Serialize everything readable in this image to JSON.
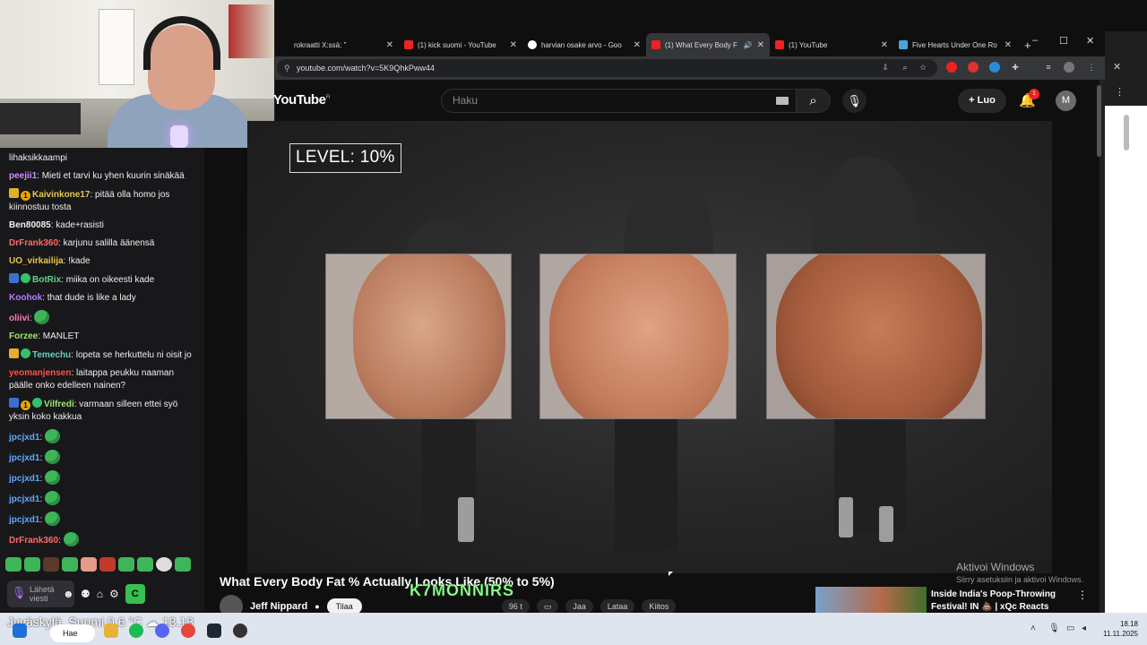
{
  "chat": {
    "messages": [
      {
        "user": "",
        "text": "lihaksikkaampi",
        "badges": []
      },
      {
        "user": "peejii1",
        "text": "Mieti et tarvi ku yhen kuurin sinäkää",
        "badges": [],
        "color": "#d68cff"
      },
      {
        "user": "Kaivinkone17",
        "text": "pitää olla homo jos kiinnostuu tosta",
        "badges": [
          "crown",
          "one"
        ],
        "color": "#e6c84a"
      },
      {
        "user": "Ben80085",
        "text": "kade+rasisti",
        "badges": [],
        "color": "#efeff1"
      },
      {
        "user": "DrFrank360",
        "text": "karjunu salilla äänensä",
        "badges": [],
        "color": "#ff6b6b"
      },
      {
        "user": "UO_virkailija",
        "text": "!kade",
        "badges": [],
        "color": "#e6c84a"
      },
      {
        "user": "BotRix",
        "text": "miika on oikeesti kade",
        "badges": [
          "blue",
          "green"
        ],
        "color": "#5fd38d"
      },
      {
        "user": "Koohok",
        "text": "that dude is like a lady",
        "badges": [],
        "color": "#b57cff"
      },
      {
        "user": "oliivi",
        "text": "",
        "badges": [],
        "color": "#ff7ab8",
        "emote": true
      },
      {
        "user": "Forzee",
        "text": "MANLET",
        "badges": [],
        "color": "#9ee66e"
      },
      {
        "user": "Temechu",
        "text": "lopeta se herkuttelu ni oisit jo",
        "badges": [
          "crown",
          "green"
        ],
        "color": "#5fd3c0"
      },
      {
        "user": "yeomanjensen",
        "text": "laitappa peukku naaman päälle onko edelleen nainen?",
        "badges": [],
        "color": "#ff4f4f"
      },
      {
        "user": "Vilfredi",
        "text": "varmaan silleen ettei syö yksin koko kakkua",
        "badges": [
          "blue",
          "one",
          "green"
        ],
        "color": "#9ee66e"
      },
      {
        "user": "jpcjxd1",
        "text": "",
        "badges": [],
        "color": "#5fa8ff",
        "emote": true
      },
      {
        "user": "jpcjxd1",
        "text": "",
        "badges": [],
        "color": "#5fa8ff",
        "emote": true
      },
      {
        "user": "jpcjxd1",
        "text": "",
        "badges": [],
        "color": "#5fa8ff",
        "emote": true
      },
      {
        "user": "jpcjxd1",
        "text": "",
        "badges": [],
        "color": "#5fa8ff",
        "emote": true
      },
      {
        "user": "jpcjxd1",
        "text": "",
        "badges": [],
        "color": "#5fa8ff",
        "emote": true
      },
      {
        "user": "DrFrank360",
        "text": "",
        "badges": [],
        "color": "#ff6b6b",
        "emote": true
      }
    ],
    "input_placeholder": "Lähetä viesti",
    "send_label": "C"
  },
  "browser": {
    "tabs": [
      {
        "title": "rokraatti X:ssä: \"",
        "icon": "x",
        "active": false
      },
      {
        "title": "(1) kick suomi - YouTube",
        "icon": "yt",
        "active": false
      },
      {
        "title": "harvian osake arvo - Goo",
        "icon": "g",
        "active": false
      },
      {
        "title": "(1) What Every Body F",
        "icon": "yt",
        "active": true
      },
      {
        "title": "(1) YouTube",
        "icon": "yt",
        "active": false
      },
      {
        "title": "Five Hearts Under One Ro",
        "icon": "tw",
        "active": false
      }
    ],
    "url": "youtube.com/watch?v=5K9QhkPww44"
  },
  "youtube": {
    "logo": "YouTube",
    "logo_region": "FI",
    "search_placeholder": "Haku",
    "create_label": "Luo",
    "notif_count": "1",
    "avatar_letter": "M",
    "overlay_level": "LEVEL: 10%",
    "video_title": "What Every Body Fat % Actually Looks Like (50% to 5%)",
    "channel": "Jeff Nippard",
    "subscribe_label": "Tilaa",
    "like_label": "96 t",
    "share_label": "Jaa",
    "download_label": "Lataa",
    "thanks_label": "Kiitos",
    "watermark": "K7MONNIRS",
    "recommendation": "Inside India's Poop-Throwing Festival! IN 💩 | xQc Reacts",
    "activate_windows": "Aktivoi Windows",
    "activate_windows_sub": "Siirry asetuksiin ja aktivoi Windows."
  },
  "taskbar": {
    "weather": "Jyväskylä, Suomi 0.6 °C",
    "weather_extra": "18.18",
    "search": "Hae",
    "time": "18.18",
    "date": "11.11.2025"
  }
}
